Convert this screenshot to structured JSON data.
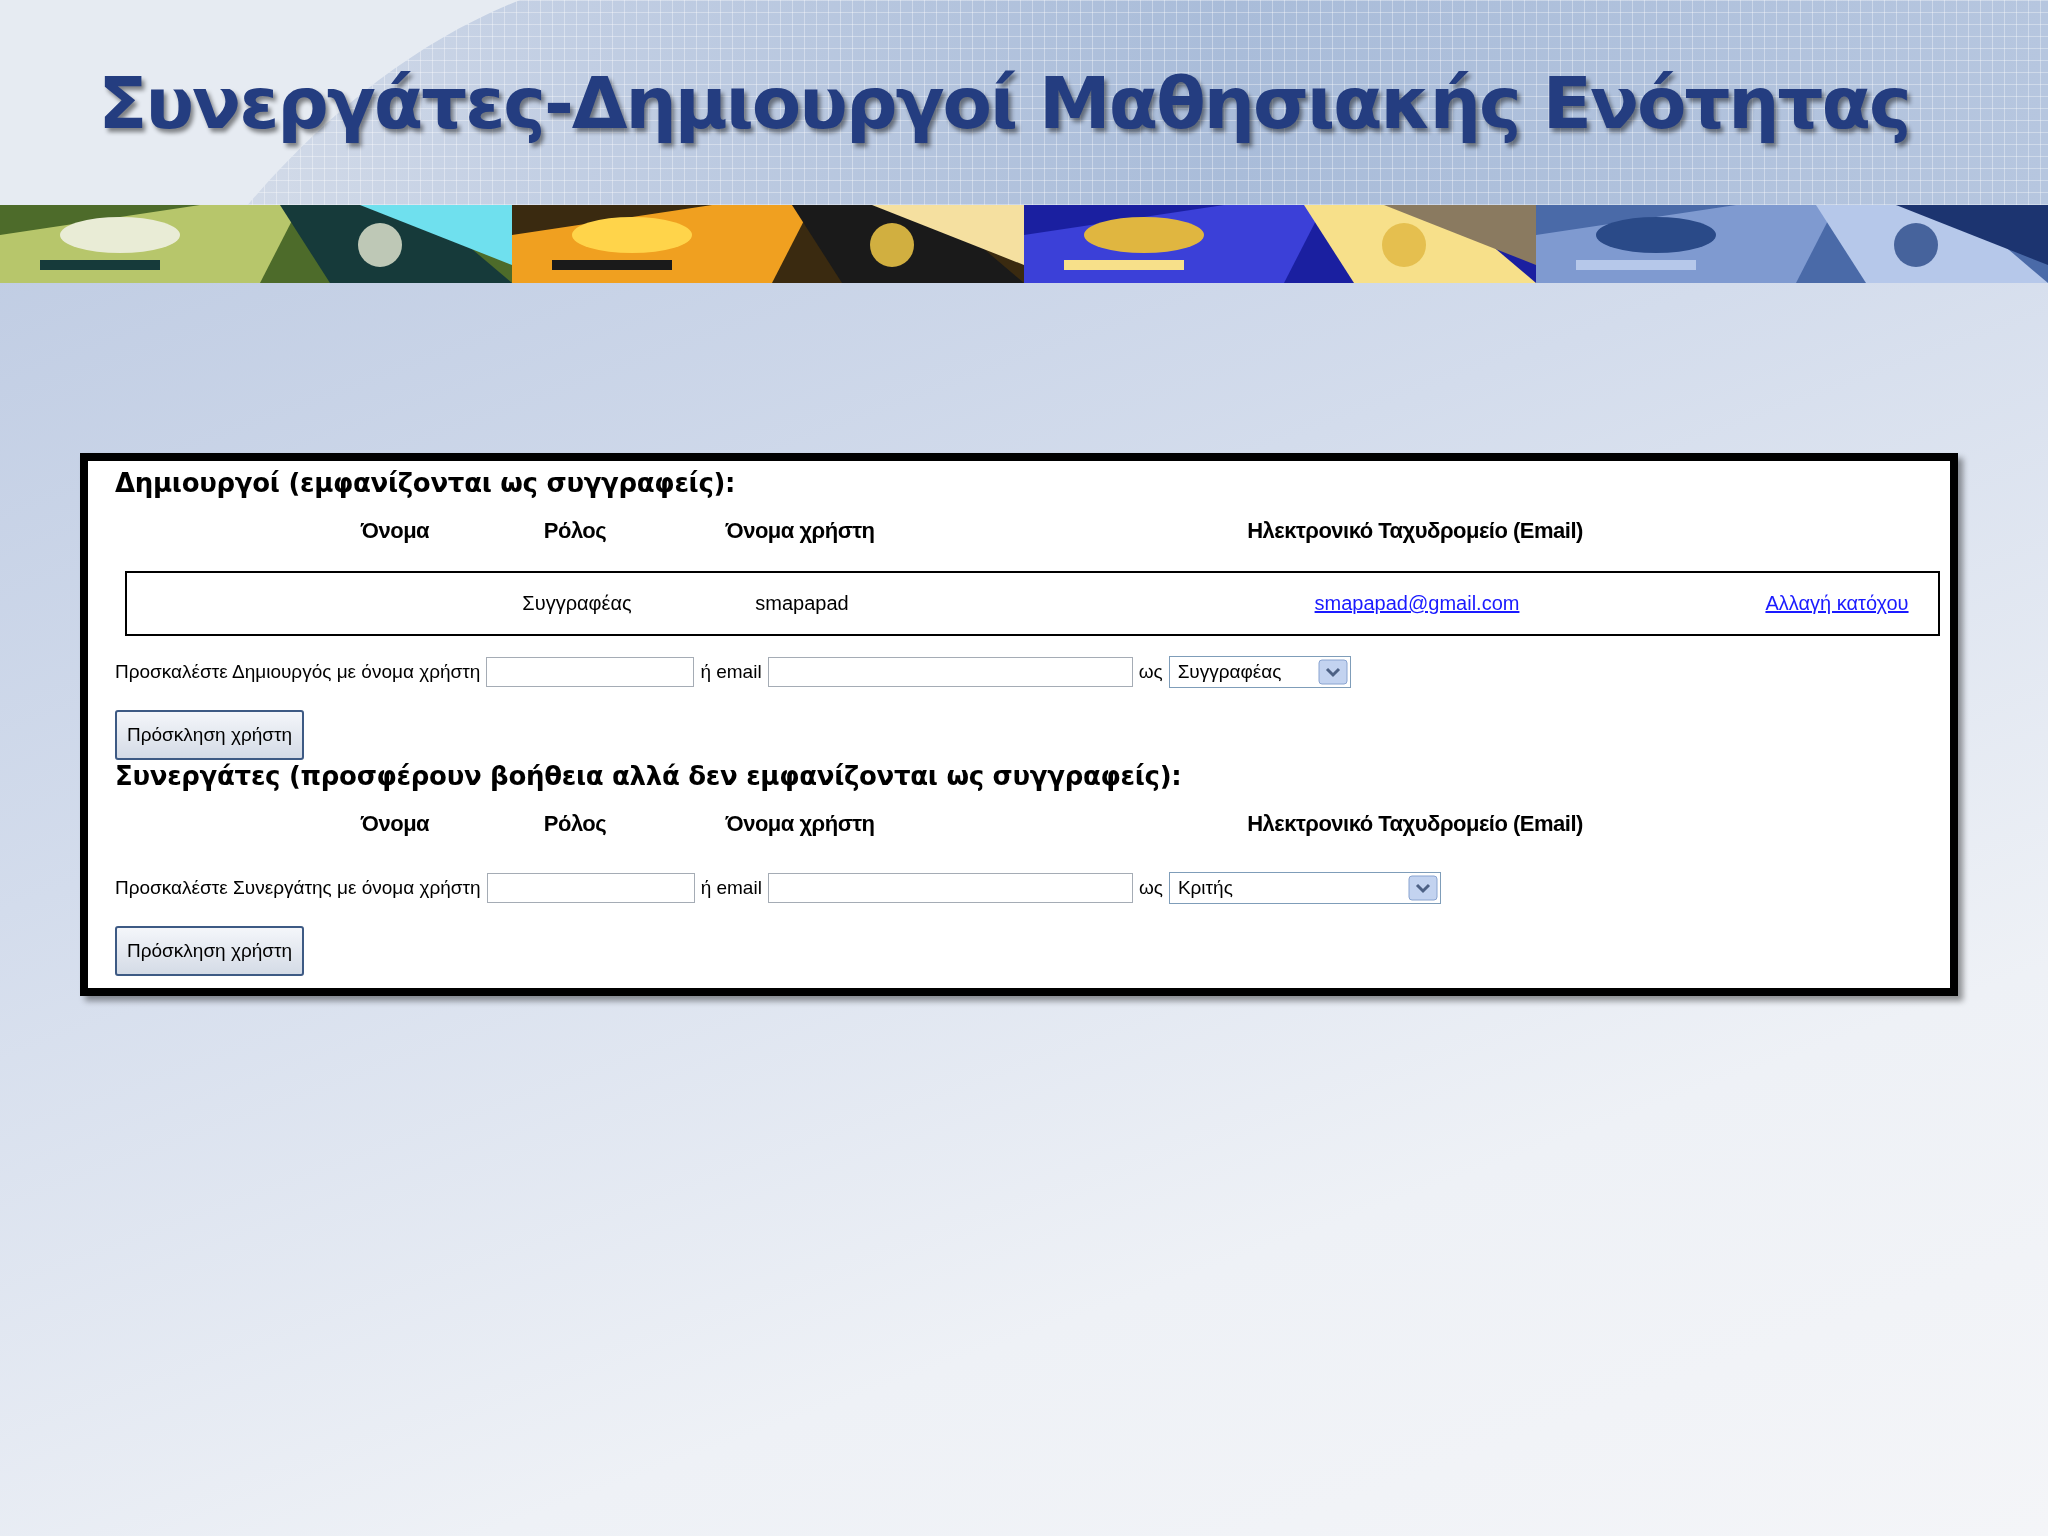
{
  "slide": {
    "title": "Συνεργάτες-Δημιουργοί Μαθησιακής Ενότητας"
  },
  "sections": [
    {
      "heading": "Δημιουργοί (εμφανίζονται ως συγγραφείς):",
      "columns": [
        "Όνομα",
        "Ρόλος",
        "Όνομα χρήστη",
        "Ηλεκτρονικό Ταχυδρομείο (Email)"
      ],
      "rows": [
        {
          "role": "Συγγραφέας",
          "username": "smapapad",
          "email": "smapapad@gmail.com",
          "action": "Αλλαγή κατόχου"
        }
      ],
      "invite": {
        "label": "Προσκαλέστε Δημιουργός με όνομα χρήστη",
        "or_label": "ή email",
        "as_label": "ως",
        "role": "Συγγραφέας",
        "button": "Πρόσκληση χρήστη"
      }
    },
    {
      "heading": "Συνεργάτες (προσφέρουν βοήθεια αλλά δεν εμφανίζονται ως συγγραφείς):",
      "columns": [
        "Όνομα",
        "Ρόλος",
        "Όνομα χρήστη",
        "Ηλεκτρονικό Ταχυδρομείο (Email)"
      ],
      "invite": {
        "label": "Προσκαλέστε Συνεργάτης με όνομα χρήστη",
        "or_label": "ή email",
        "as_label": "ως",
        "role": "Κριτής",
        "button": "Πρόσκληση χρήστη"
      }
    }
  ]
}
